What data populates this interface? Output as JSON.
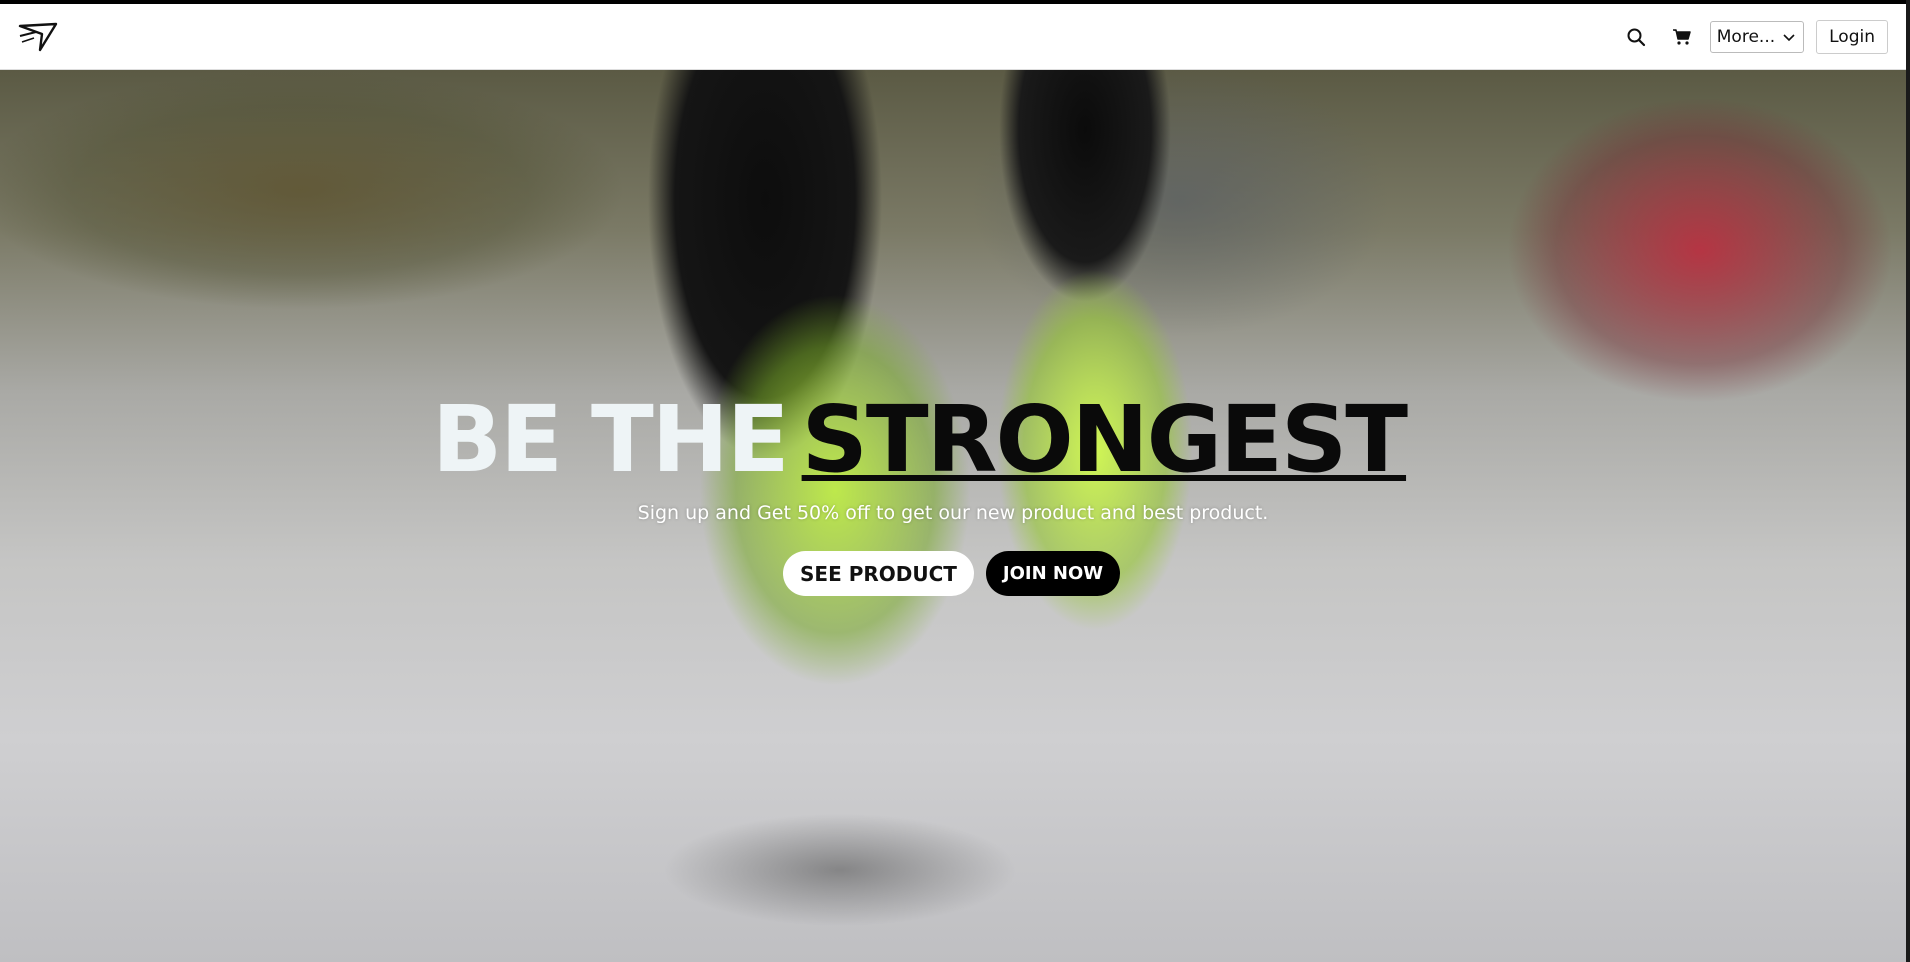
{
  "navbar": {
    "logo_icon": "gymshark-shark-logo-icon",
    "search_icon": "search-icon",
    "cart_icon": "cart-icon",
    "more_label": "More...",
    "login_label": "Login"
  },
  "hero": {
    "headline_light": "BE THE",
    "headline_dark": "STRONGEST",
    "tagline": "Sign up and Get 50% off to get our new product and best product.",
    "see_product_label": "SEE PRODUCT",
    "join_now_label": "JOIN NOW"
  },
  "colors": {
    "accent_light": "#eef4f6",
    "accent_dark": "#0a0a0a",
    "button_white": "#ffffff",
    "button_black": "#000000"
  }
}
